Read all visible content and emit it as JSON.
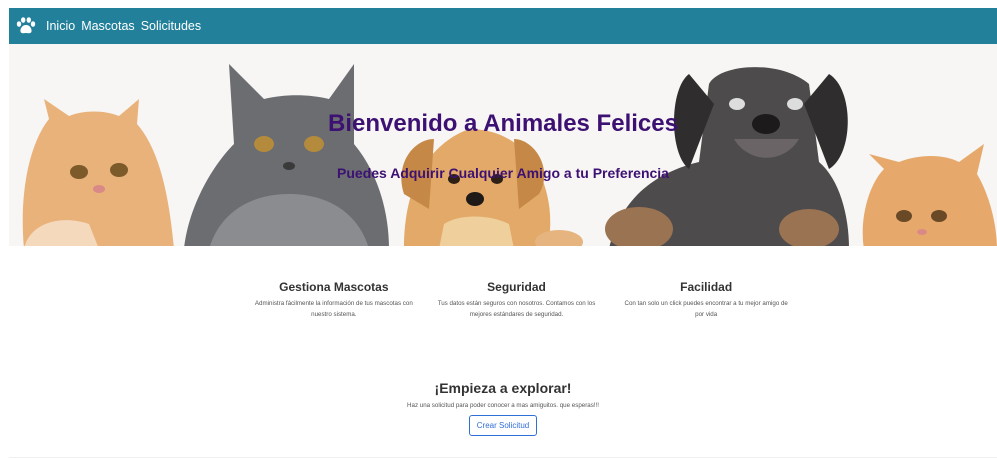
{
  "navbar": {
    "brand_icon": "paw-icon",
    "links": [
      {
        "label": "Inicio"
      },
      {
        "label": "Mascotas"
      },
      {
        "label": "Solicitudes"
      }
    ],
    "color": "#22809b"
  },
  "hero": {
    "title": "Bienvenido a Animales Felices",
    "subtitle": "Puedes Adquirir Cualquier Amigo a tu Preferencia",
    "text_color": "#3d1173"
  },
  "features": [
    {
      "title": "Gestiona Mascotas",
      "text": "Administra fácilmente la información de tus mascotas con nuestro sistema."
    },
    {
      "title": "Seguridad",
      "text": "Tus datos están seguros con nosotros. Contamos con los mejores estándares de seguridad."
    },
    {
      "title": "Facilidad",
      "text": "Con tan solo un click puedes encontrar a tu mejor amigo de por vida"
    }
  ],
  "cta": {
    "title": "¡Empieza a explorar!",
    "text": "Haz una solicitud para poder conocer a mas amiguitos. que esperas!!!",
    "button_label": "Crear Solicitud",
    "button_color": "#2f6fd8"
  }
}
